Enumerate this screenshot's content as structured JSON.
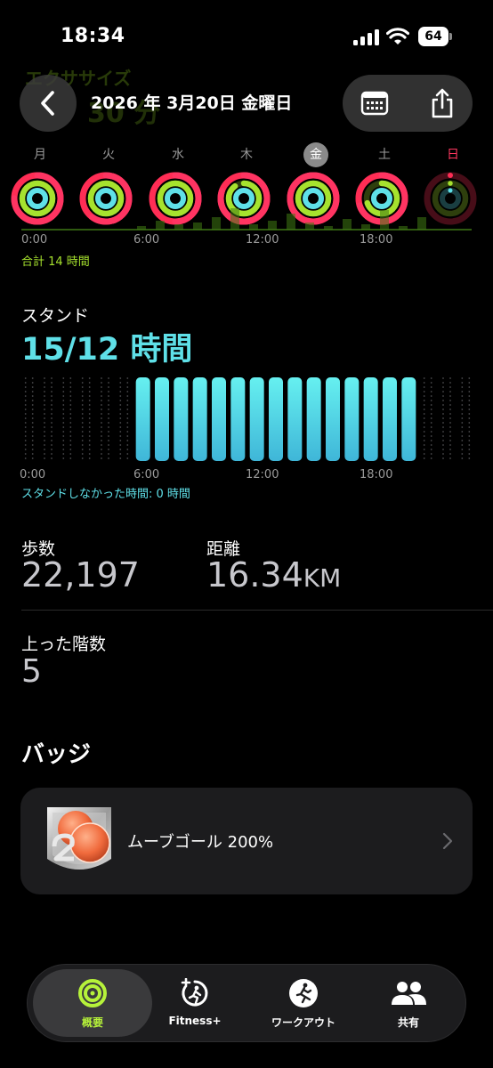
{
  "status_bar": {
    "time": "18:34",
    "battery": "64"
  },
  "background_title": {
    "label": "エクササイズ",
    "value": "30 分"
  },
  "header": {
    "date": "2026 年 3月20日 金曜日"
  },
  "week": {
    "days": [
      {
        "label": "月",
        "move": 1.75,
        "exercise": 1.0,
        "stand": 1.0
      },
      {
        "label": "火",
        "move": 1.6,
        "exercise": 1.0,
        "stand": 1.0
      },
      {
        "label": "水",
        "move": 1.5,
        "exercise": 1.0,
        "stand": 1.0
      },
      {
        "label": "木",
        "move": 1.8,
        "exercise": 0.9,
        "stand": 1.0
      },
      {
        "label": "金",
        "move": 2.0,
        "exercise": 1.0,
        "stand": 1.0
      },
      {
        "label": "土",
        "move": 1.7,
        "exercise": 0.7,
        "stand": 1.0
      },
      {
        "label": "日",
        "move": 0.0,
        "exercise": 0.0,
        "stand": 0.0
      }
    ],
    "hour_labels": [
      "0:00",
      "6:00",
      "12:00",
      "18:00"
    ],
    "total": "合計 14 時間"
  },
  "stand": {
    "title": "スタンド",
    "value": "15/12 時間",
    "hours_stood": [
      0,
      0,
      0,
      0,
      0,
      0,
      1,
      1,
      1,
      1,
      1,
      1,
      1,
      1,
      1,
      1,
      1,
      1,
      1,
      1,
      1,
      0,
      0,
      0
    ],
    "hour_labels": [
      "0:00",
      "6:00",
      "12:00",
      "18:00"
    ],
    "footer": "スタンドしなかった時間: 0 時間"
  },
  "stats": {
    "steps_label": "歩数",
    "steps_value": "22,197",
    "distance_label": "距離",
    "distance_value": "16.34",
    "distance_unit": "KM",
    "floors_label": "上った階数",
    "floors_value": "5"
  },
  "badges": {
    "title": "バッジ",
    "items": [
      {
        "label": "ムーブゴール 200%",
        "icon": "move-goal-200-badge"
      }
    ]
  },
  "tab_bar": {
    "tabs": [
      {
        "label": "概要",
        "icon": "activity-rings-icon"
      },
      {
        "label": "Fitness+",
        "icon": "fitness-plus-icon"
      },
      {
        "label": "ワークアウト",
        "icon": "running-figure-icon"
      },
      {
        "label": "共有",
        "icon": "people-icon"
      }
    ]
  },
  "colors": {
    "move": "#ff2d55",
    "exercise": "#a6e22e",
    "stand": "#5fe0e8",
    "background": "#000000",
    "card": "#1c1c1e"
  }
}
